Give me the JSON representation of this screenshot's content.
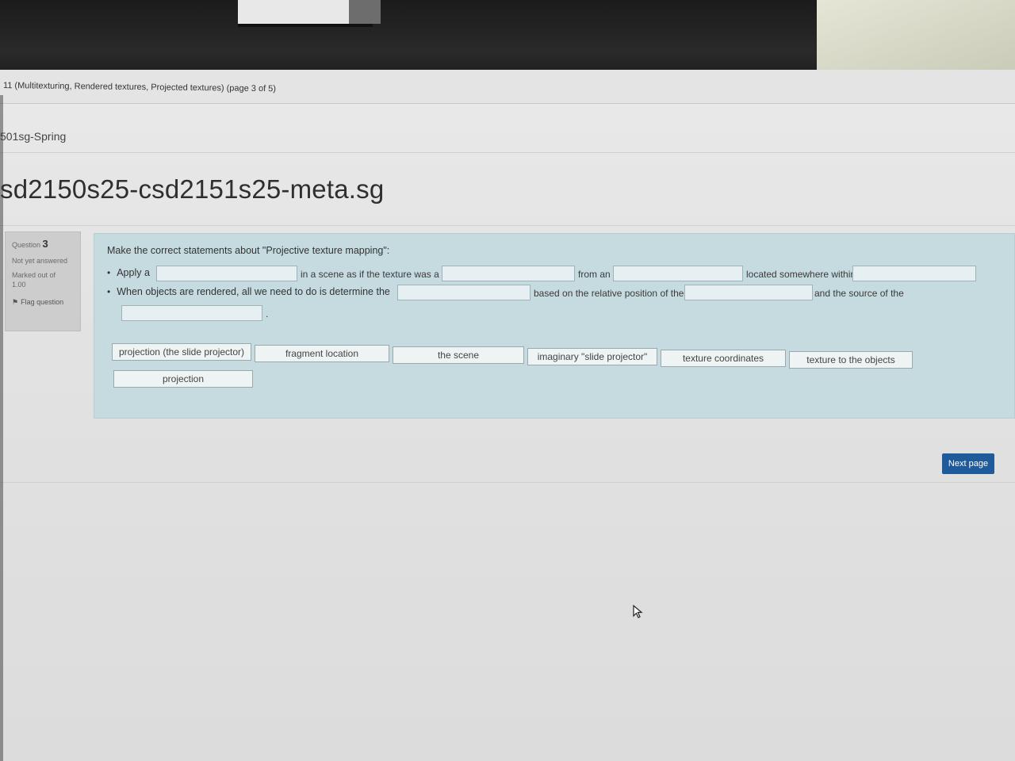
{
  "browser": {
    "tab_title": "11 (Multitexturing, Rendered textures, Projected textures) (page 3 of 5)"
  },
  "breadcrumb": "501sg-Spring",
  "course_title": "sd2150s25-csd2151s25-meta.sg",
  "question_info": {
    "label": "Question",
    "number": "3",
    "status": "Not yet answered",
    "marked_label": "Marked out of",
    "marked_value": "1.00",
    "flag_label": "Flag question",
    "flag_icon": "flag-icon"
  },
  "question": {
    "prompt": "Make the correct statements about \"Projective texture mapping\":",
    "bullet1": {
      "s1": "Apply a",
      "s2": "in a scene as if the texture was a",
      "s3": "from an",
      "s4": "located somewhere within"
    },
    "bullet2": {
      "s1": "When objects are rendered, all we need to do is determine the",
      "s2": "based on the relative position of the",
      "s3": "and the source of the",
      "s4": "."
    }
  },
  "choices": [
    "projection (the slide projector)",
    "fragment location",
    "the scene",
    "imaginary \"slide projector\"",
    "texture coordinates",
    "texture to the objects",
    "projection"
  ],
  "navigation": {
    "next_label": "Next page"
  },
  "colors": {
    "question_bg": "#c6dbdf",
    "next_button": "#1f5b9a"
  }
}
